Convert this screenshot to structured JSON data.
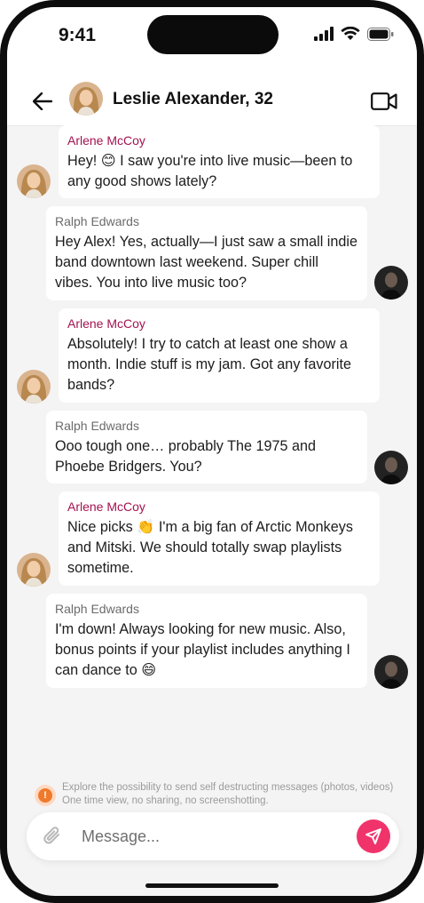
{
  "status_bar": {
    "time": "9:41"
  },
  "header": {
    "title": "Leslie Alexander, 32"
  },
  "messages": [
    {
      "sender": "Arlene McCoy",
      "text": "Hey! 😊 I saw you're into live music—been to any good shows lately?"
    },
    {
      "sender": "Ralph Edwards",
      "text": "Hey Alex! Yes, actually—I just saw a small indie band downtown last weekend. Super chill vibes. You into live music too?"
    },
    {
      "sender": "Arlene McCoy",
      "text": "Absolutely! I try to catch at least one show a month. Indie stuff is my jam. Got any favorite bands?"
    },
    {
      "sender": "Ralph Edwards",
      "text": "Ooo tough one… probably The 1975 and Phoebe Bridgers. You?"
    },
    {
      "sender": "Arlene McCoy",
      "text": "Nice picks 👏 I'm a big fan of Arctic Monkeys and Mitski. We should totally swap playlists sometime."
    },
    {
      "sender": "Ralph Edwards",
      "text": "I'm down! Always looking for new music. Also, bonus points if your playlist includes anything I can dance to 😄"
    }
  ],
  "notice": {
    "text": "Explore the possibility to send self destructing messages (photos, videos) One time view, no sharing, no screenshotting."
  },
  "composer": {
    "placeholder": "Message..."
  },
  "colors": {
    "accent": "#f0336b",
    "incoming_sender": "#a3124f",
    "outgoing_sender": "#6b6b6b",
    "background": "#f4f4f4"
  }
}
